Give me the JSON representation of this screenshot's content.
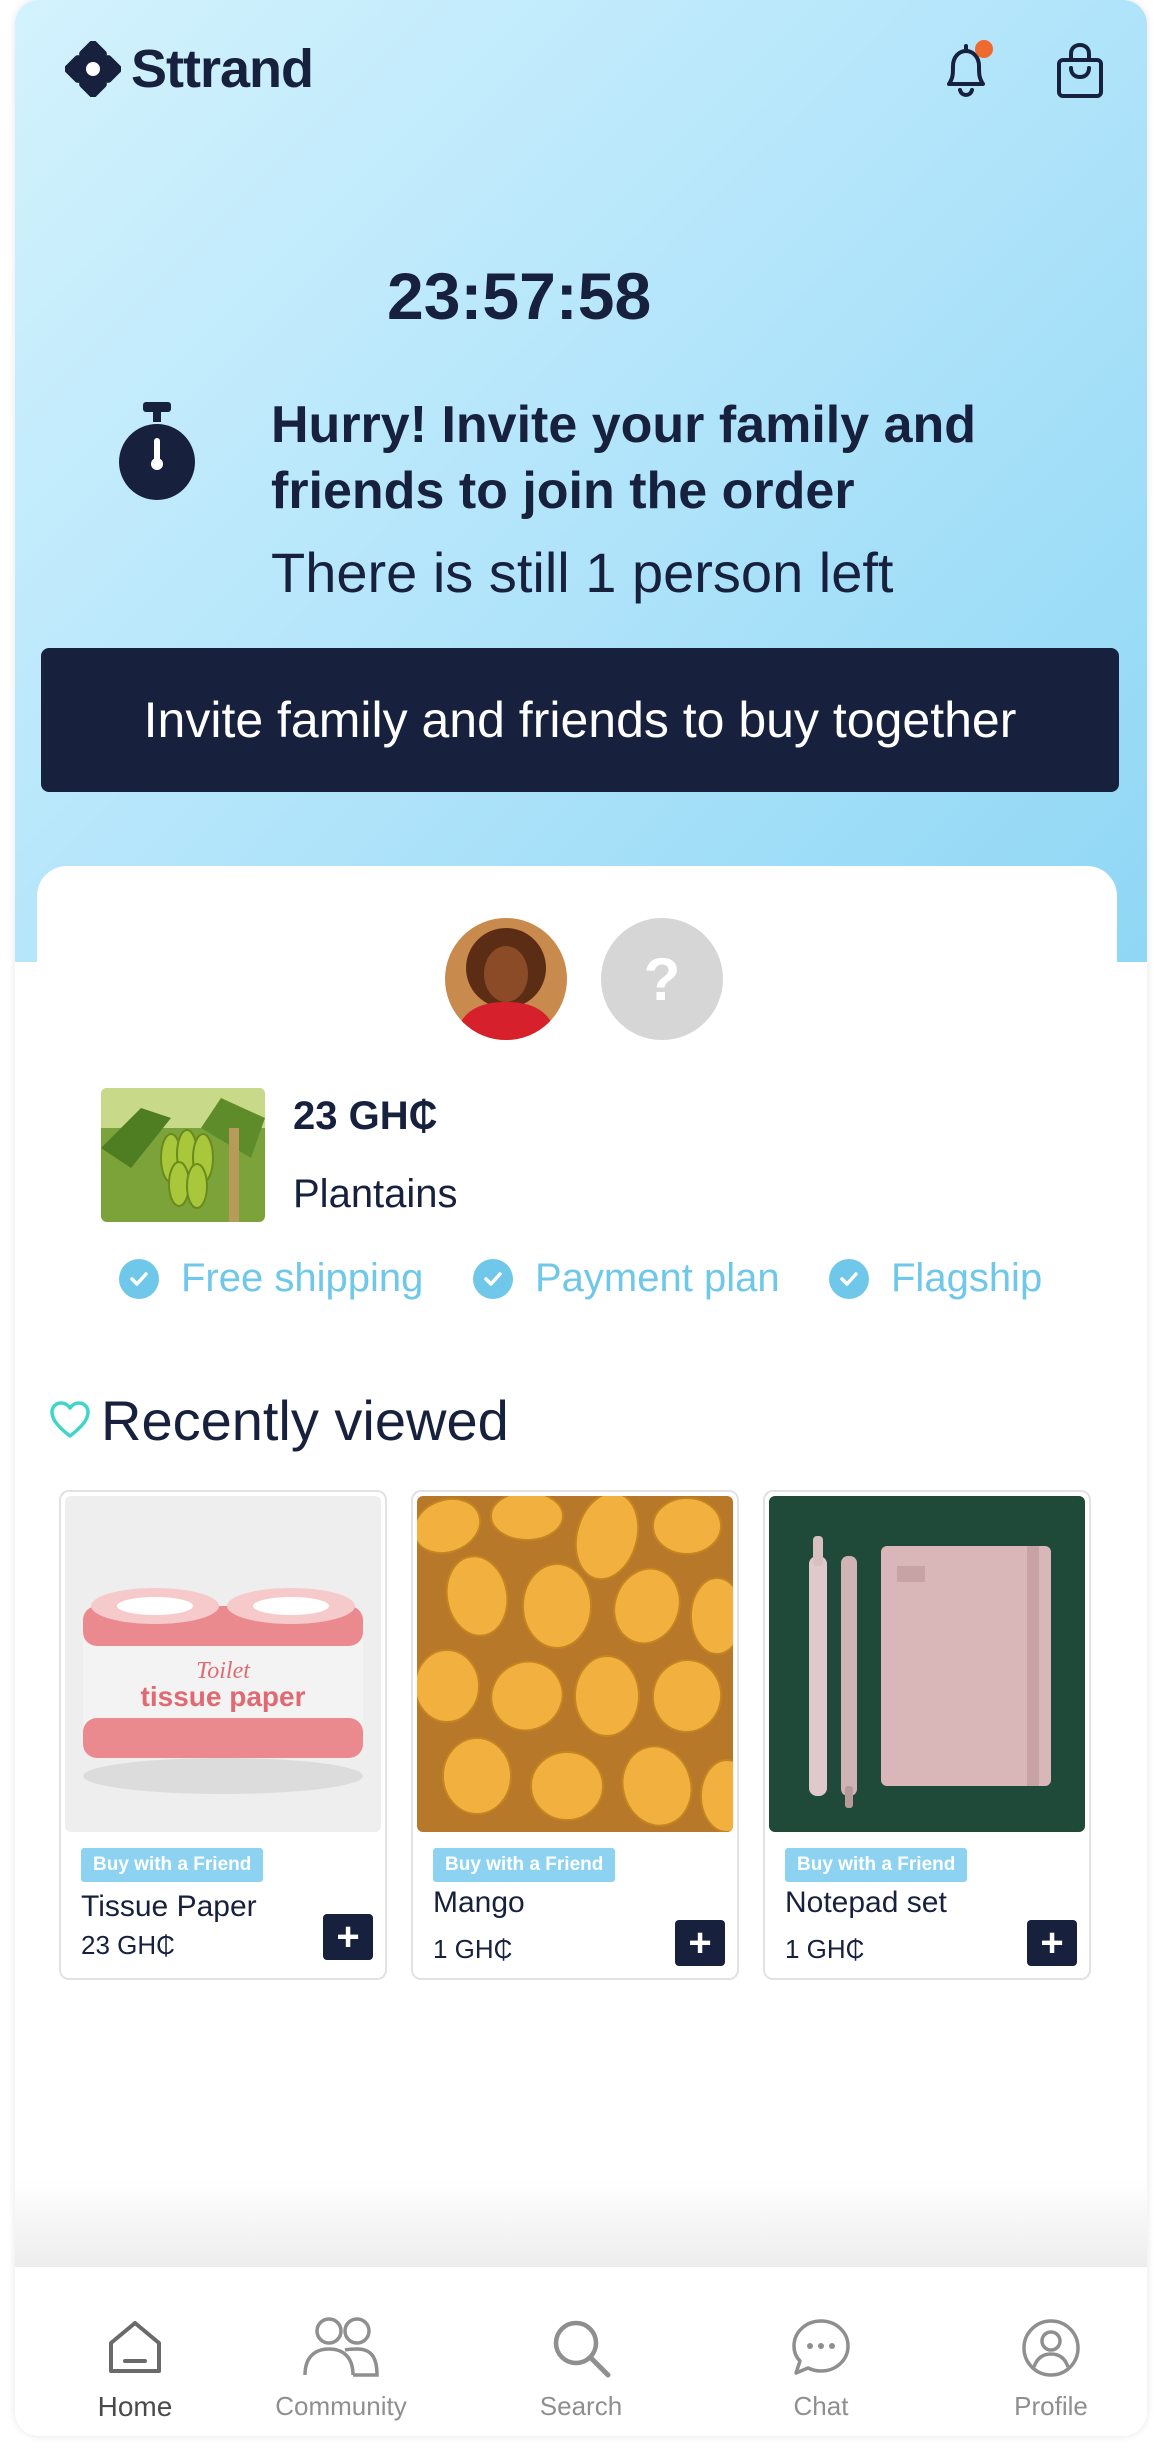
{
  "header": {
    "brand": "Sttrand",
    "notification_icon": "bell-icon",
    "cart_icon": "shopping-bag-icon",
    "notification_dot_color": "#ef6a2e"
  },
  "countdown": {
    "time": "23:57:58"
  },
  "invite": {
    "headline": "Hurry! Invite your family and friends to join the order",
    "subtext": "There is still 1 person left",
    "button_label": "Invite family and friends to buy together"
  },
  "group_order": {
    "members": [
      {
        "type": "photo"
      },
      {
        "type": "placeholder",
        "label": "?"
      }
    ],
    "product": {
      "price": "23 GH₵",
      "name": "Plantains"
    },
    "features": [
      "Free shipping",
      "Payment plan",
      "Flagship"
    ]
  },
  "recently_viewed": {
    "title": "Recently viewed",
    "items": [
      {
        "badge": "Buy with a Friend",
        "name": "Tissue Paper",
        "price": "23 GH₵",
        "image_title": "Toilet",
        "image_subtitle": "tissue paper"
      },
      {
        "badge": "Buy with a Friend",
        "name": "Mango",
        "price": "1 GH₵"
      },
      {
        "badge": "Buy with a Friend",
        "name": "Notepad set",
        "price": "1 GH₵"
      }
    ]
  },
  "nav": {
    "items": [
      {
        "label": "Home",
        "icon": "home-icon",
        "active": true
      },
      {
        "label": "Community",
        "icon": "community-icon",
        "active": false
      },
      {
        "label": "Search",
        "icon": "search-icon",
        "active": false
      },
      {
        "label": "Chat",
        "icon": "chat-icon",
        "active": false
      },
      {
        "label": "Profile",
        "icon": "profile-icon",
        "active": false
      }
    ]
  },
  "colors": {
    "navy": "#17213d",
    "accent": "#6fc7ea",
    "badge": "#8dd3f1",
    "teal_heart": "#3ed6c8"
  }
}
